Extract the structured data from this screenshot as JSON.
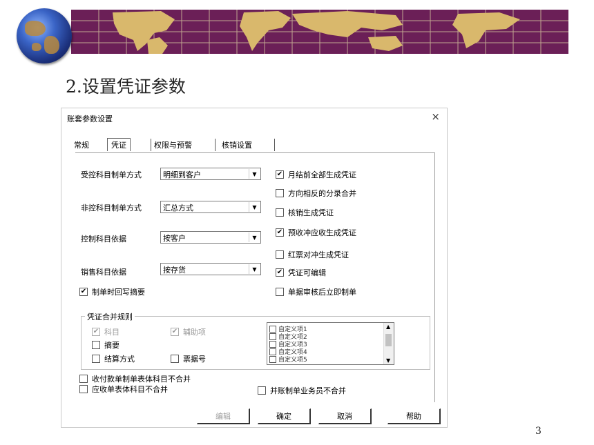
{
  "slide": {
    "title": "2.设置凭证参数",
    "page_number": "3"
  },
  "dialog": {
    "title": "账套参数设置",
    "close_icon": "×",
    "tabs": [
      {
        "label": "常规"
      },
      {
        "label": "凭证",
        "active": true
      },
      {
        "label": "权限与预警"
      },
      {
        "label": "核销设置"
      }
    ],
    "fields": [
      {
        "label": "受控科目制单方式",
        "value": "明细到客户"
      },
      {
        "label": "非控科目制单方式",
        "value": "汇总方式"
      },
      {
        "label": "控制科目依据",
        "value": "按客户"
      },
      {
        "label": "销售科目依据",
        "value": "按存货"
      }
    ],
    "checkbox_writeback": {
      "label": "制单时回写摘要",
      "checked": true
    },
    "right_options": [
      {
        "label": "月结前全部生成凭证",
        "checked": true
      },
      {
        "label": "方向相反的分录合并",
        "checked": false
      },
      {
        "label": "核销生成凭证",
        "checked": false
      },
      {
        "label": "预收冲应收生成凭证",
        "checked": true
      },
      {
        "label": "红票对冲生成凭证",
        "checked": false
      },
      {
        "label": "凭证可编辑",
        "checked": true
      },
      {
        "label": "单据审核后立即制单",
        "checked": false
      }
    ],
    "merge_rules": {
      "title": "凭证合并规则",
      "options": [
        {
          "label": "科目",
          "checked": true,
          "disabled": true
        },
        {
          "label": "辅助项",
          "checked": true,
          "disabled": true
        },
        {
          "label": "摘要",
          "checked": false
        },
        {
          "label": "结算方式",
          "checked": false
        },
        {
          "label": "票据号",
          "checked": false
        }
      ],
      "list_items": [
        "自定义项1",
        "自定义项2",
        "自定义项3",
        "自定义项4",
        "自定义项5"
      ]
    },
    "bottom_options": [
      {
        "label": "收付款单制单表体科目不合并",
        "checked": false
      },
      {
        "label": "应收单表体科目不合并",
        "checked": false
      },
      {
        "label": "并账制单业务员不合并",
        "checked": false
      }
    ],
    "buttons": [
      {
        "label": "编辑",
        "disabled": true
      },
      {
        "label": "确定"
      },
      {
        "label": "取消"
      },
      {
        "label": "帮助"
      }
    ],
    "check_mark": "✔"
  }
}
